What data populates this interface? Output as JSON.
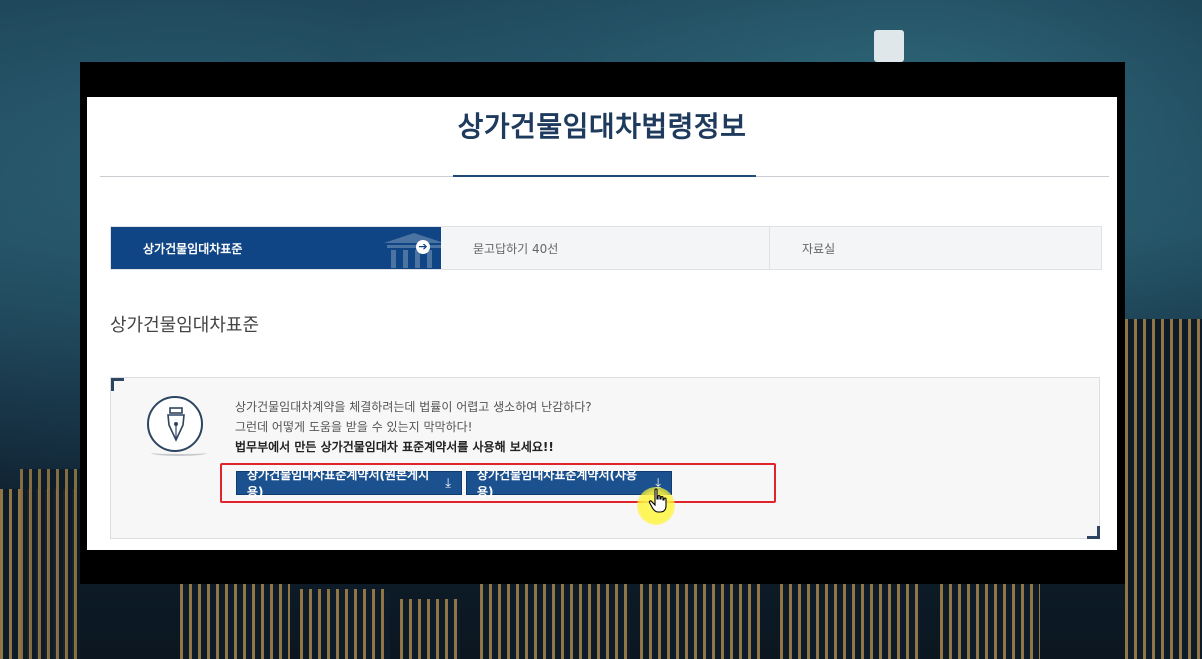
{
  "page": {
    "title": "상가건물임대차법령정보"
  },
  "tabs": [
    {
      "label": "상가건물임대차표준",
      "active": true
    },
    {
      "label": "묻고답하기 40선",
      "active": false
    },
    {
      "label": "자료실",
      "active": false
    }
  ],
  "section": {
    "title": "상가건물임대차표준"
  },
  "info": {
    "line1": "상가건물임대차계약을 체결하려는데 법률이 어렵고 생소하여 난감하다?",
    "line2": "그런데 어떻게 도움을 받을 수 있는지 막막하다!",
    "line3": "법무부에서 만든 상가건물임대차 표준계약서를 사용해 보세요!!"
  },
  "buttons": {
    "original": "상가건물임대차표준계약서(원본게시용)",
    "use": "상가건물임대차표준계약서(사용용)"
  },
  "icons": {
    "download": "download-icon",
    "pen": "fountain-pen-icon",
    "tab_arrow": "arrow-right-circle-icon",
    "cursor": "hand-pointer-icon"
  },
  "colors": {
    "brand_navy": "#1e3b5e",
    "tab_active": "#0f4585",
    "button": "#1c5190",
    "highlight": "#e0242b"
  }
}
